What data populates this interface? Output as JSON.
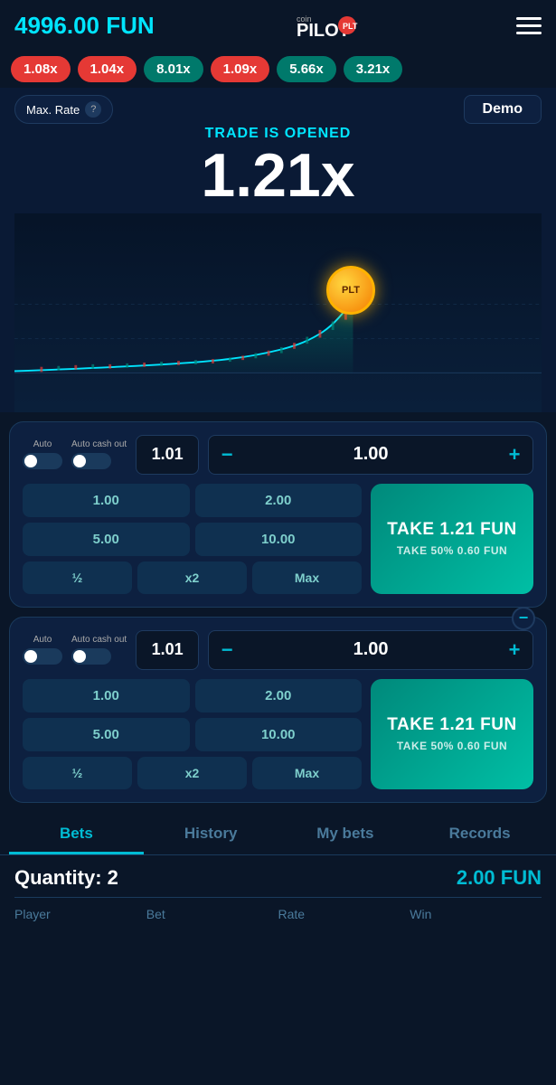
{
  "header": {
    "balance": "4996.00 FUN",
    "logo_text": "coin PILOT",
    "menu_label": "menu"
  },
  "pills": [
    {
      "value": "1.08x",
      "type": "red"
    },
    {
      "value": "1.04x",
      "type": "red"
    },
    {
      "value": "8.01x",
      "type": "teal"
    },
    {
      "value": "1.09x",
      "type": "red"
    },
    {
      "value": "5.66x",
      "type": "teal"
    },
    {
      "value": "3.21x",
      "type": "teal"
    }
  ],
  "trade": {
    "status": "TRADE IS OPENED",
    "multiplier": "1.21x",
    "max_rate_label": "Max. Rate",
    "demo_label": "Demo",
    "plt_coin_label": "PLT"
  },
  "panel1": {
    "auto_label": "Auto",
    "auto_cashout_label": "Auto cash out",
    "cashout_value": "1.01",
    "amount": "1.00",
    "quick_bets": [
      "1.00",
      "2.00",
      "5.00",
      "10.00"
    ],
    "modifiers": [
      "½",
      "x2",
      "Max"
    ],
    "take_main": "TAKE 1.21 FUN",
    "take_sub": "TAKE 50% 0.60 FUN"
  },
  "panel2": {
    "auto_label": "Auto",
    "auto_cashout_label": "Auto cash out",
    "cashout_value": "1.01",
    "amount": "1.00",
    "quick_bets": [
      "1.00",
      "2.00",
      "5.00",
      "10.00"
    ],
    "modifiers": [
      "½",
      "x2",
      "Max"
    ],
    "take_main": "TAKE 1.21 FUN",
    "take_sub": "TAKE 50%  0.60 FUN",
    "minus_label": "−"
  },
  "tabs": [
    {
      "label": "Bets",
      "active": true
    },
    {
      "label": "History",
      "active": false
    },
    {
      "label": "My bets",
      "active": false
    },
    {
      "label": "Records",
      "active": false
    }
  ],
  "bets_section": {
    "quantity_label": "Quantity: 2",
    "total_value": "2.00 FUN",
    "columns": [
      "Player",
      "Bet",
      "Rate",
      "Win"
    ]
  }
}
